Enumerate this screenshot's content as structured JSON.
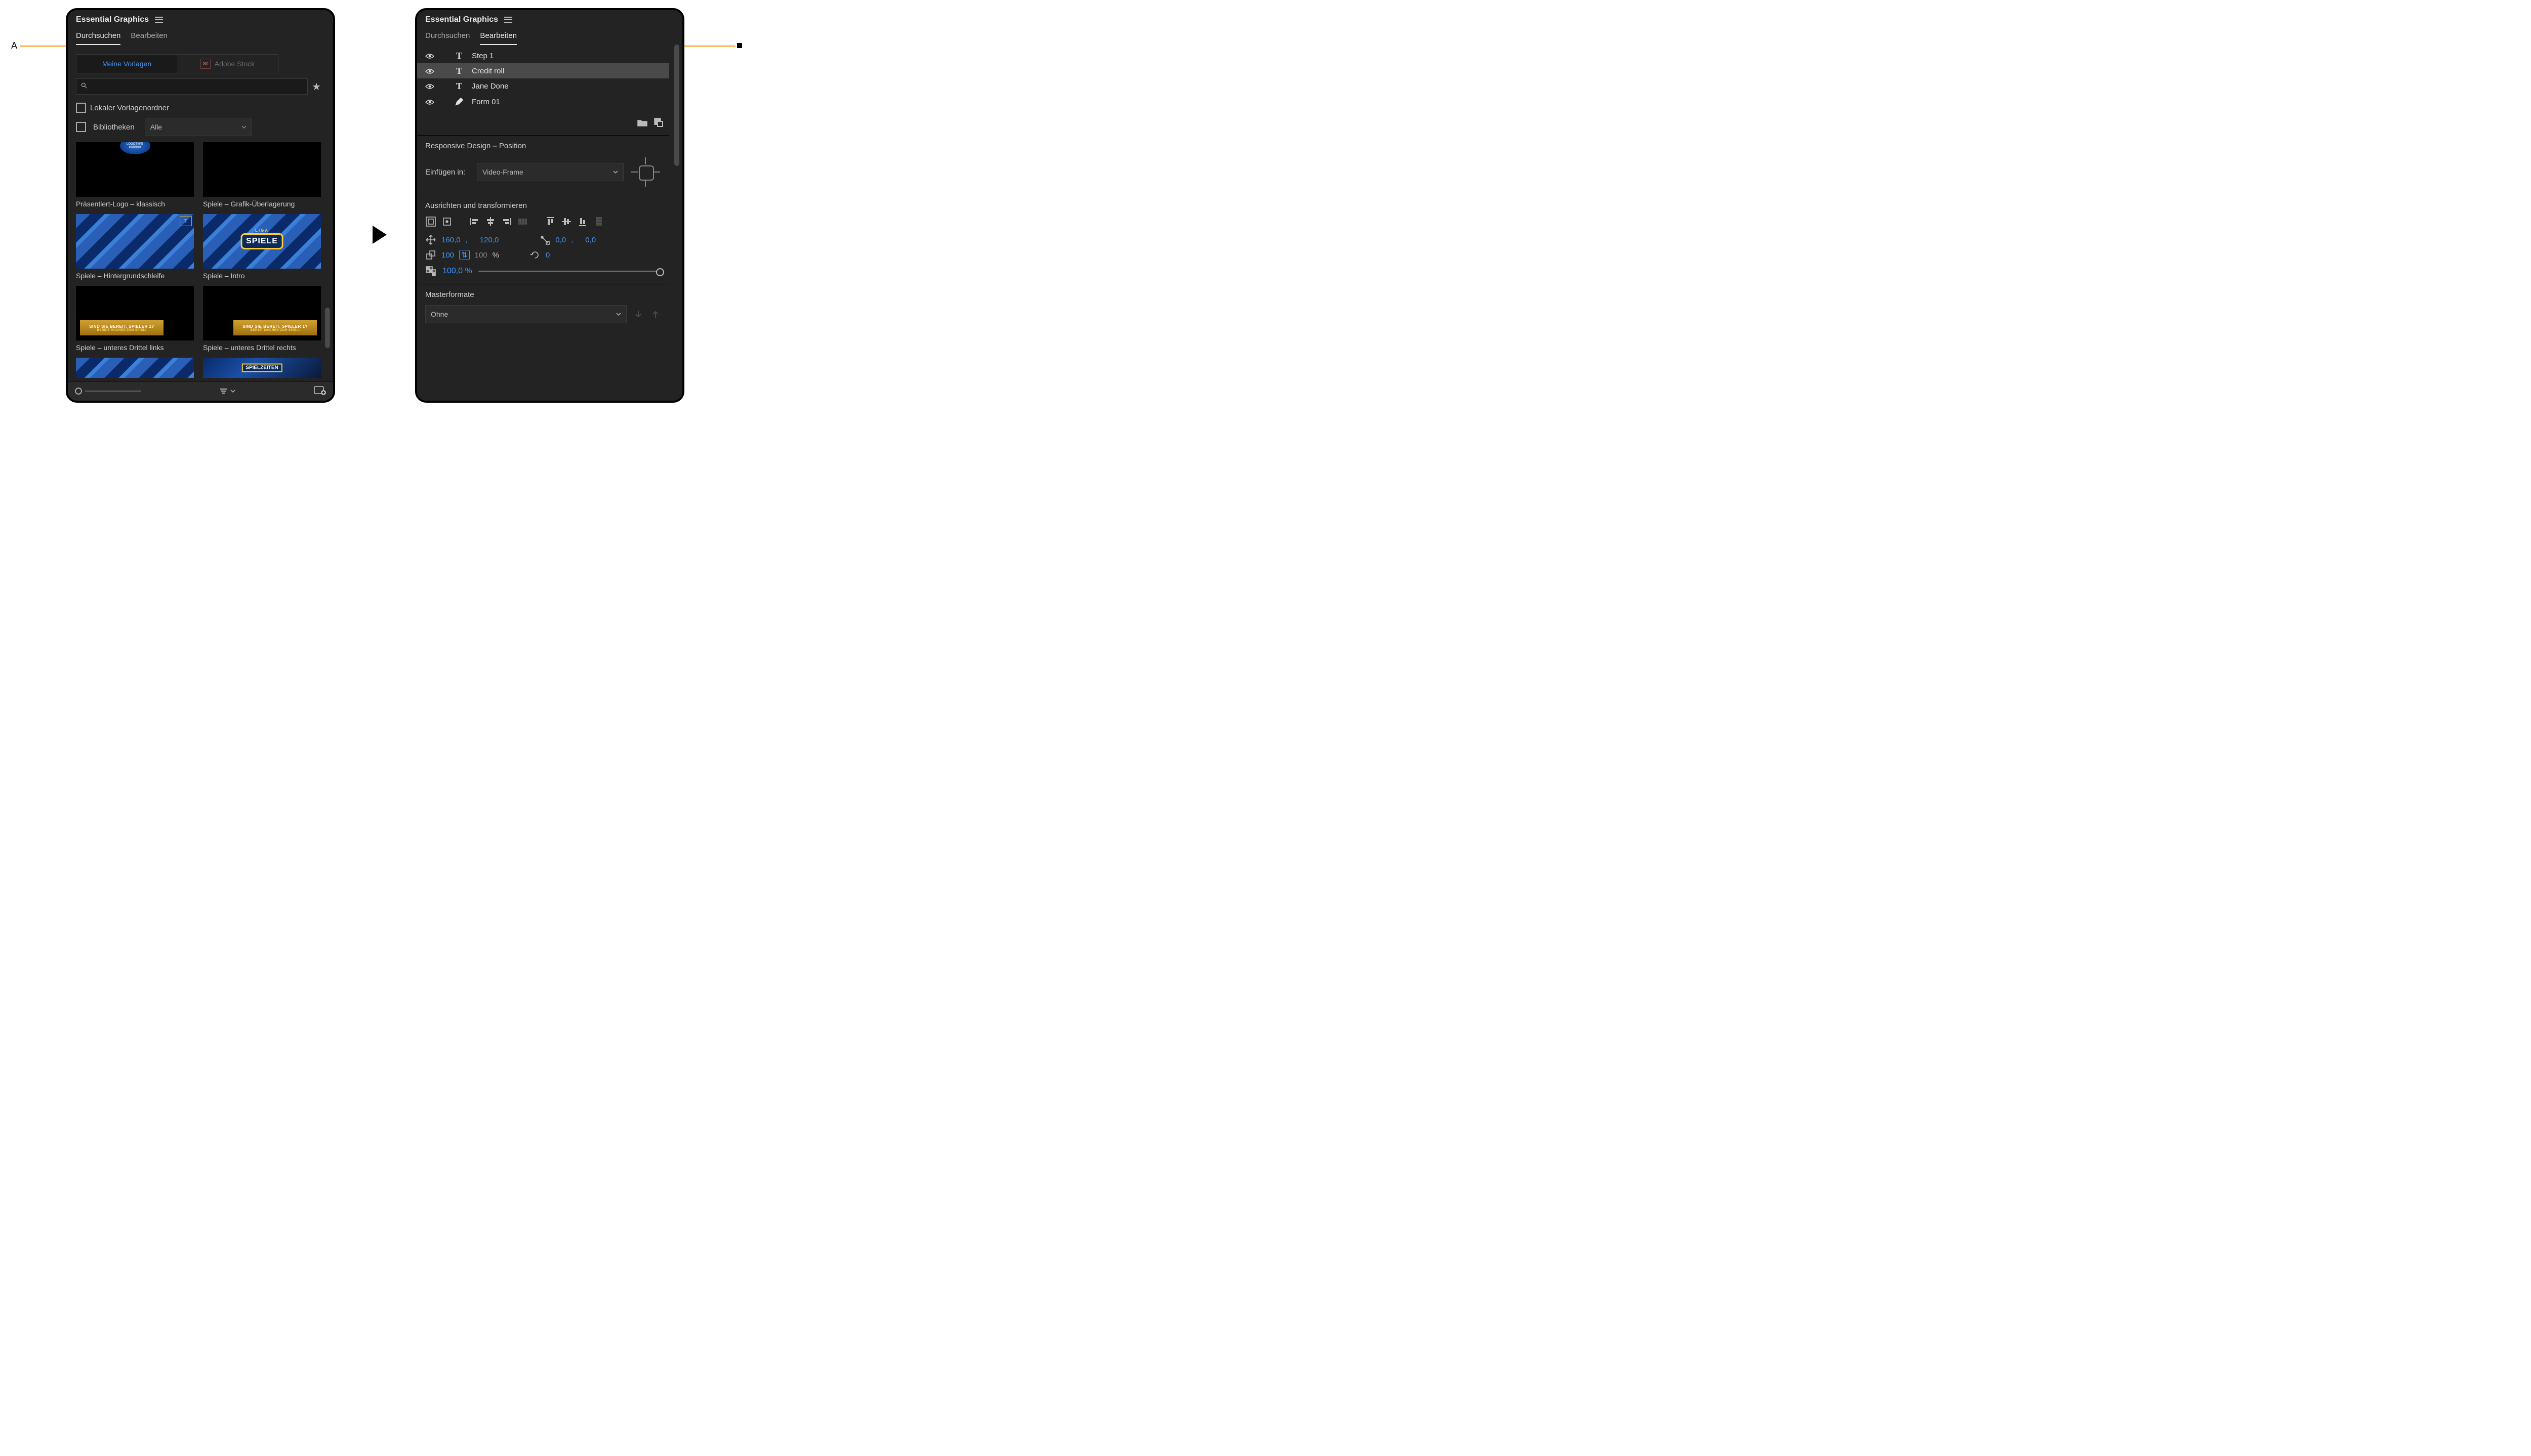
{
  "panel_title": "Essential Graphics",
  "left": {
    "tabs": {
      "browse": "Durchsuchen",
      "edit": "Bearbeiten"
    },
    "source_toggle": {
      "my_templates": "Meine Vorlagen",
      "adobe_stock": "Adobe Stock",
      "stock_badge": "St"
    },
    "search": {
      "placeholder": ""
    },
    "checkboxes": {
      "local_folder": "Lokaler Vorlagenordner",
      "libraries": "Bibliotheken"
    },
    "libraries_filter": "Alle",
    "templates": [
      {
        "label": "Präsentiert-Logo – klassisch",
        "kind": "logo"
      },
      {
        "label": "Spiele – Grafik-Überlagerung",
        "kind": "black"
      },
      {
        "label": "Spiele – Hintergrundschleife",
        "kind": "blue-loop"
      },
      {
        "label": "Spiele – Intro",
        "kind": "spiele-intro"
      },
      {
        "label": "Spiele – unteres Drittel links",
        "kind": "lower-third"
      },
      {
        "label": "Spiele – unteres Drittel rechts",
        "kind": "lower-third"
      },
      {
        "label": "",
        "kind": "blue-loop2"
      },
      {
        "label": "",
        "kind": "spielzeiten"
      }
    ],
    "thumb_text": {
      "logotype": "LOGOTYPE",
      "presents": "präsentiert",
      "liga": "LIGA",
      "spiele": "SPIELE",
      "ready": "SIND SIE BEREIT, SPIELER 1?",
      "ready_sub": "BEREIT MACHEN ZUM SPIEL!",
      "spielzeiten": "SPIELZEITEN"
    }
  },
  "right": {
    "tabs": {
      "browse": "Durchsuchen",
      "edit": "Bearbeiten"
    },
    "layers": [
      {
        "name": "Step 1",
        "type": "text",
        "selected": false
      },
      {
        "name": "Credit roll",
        "type": "text",
        "selected": true
      },
      {
        "name": "Jane Done",
        "type": "text",
        "selected": false
      },
      {
        "name": "Form 01",
        "type": "shape",
        "selected": false
      }
    ],
    "responsive": {
      "title": "Responsive Design – Position",
      "insert_label": "Einfügen in:",
      "insert_value": "Video-Frame"
    },
    "align": {
      "title": "Ausrichten und transformieren",
      "position": {
        "x": "160,0",
        "y": "120,0"
      },
      "anchor": {
        "x": "0,0",
        "y": "0,0"
      },
      "scale": {
        "w": "100",
        "h": "100",
        "unit": "%"
      },
      "rotation": "0",
      "opacity": "100,0 %"
    },
    "master": {
      "title": "Masterformate",
      "value": "Ohne"
    }
  },
  "annotations": {
    "a": "A"
  }
}
